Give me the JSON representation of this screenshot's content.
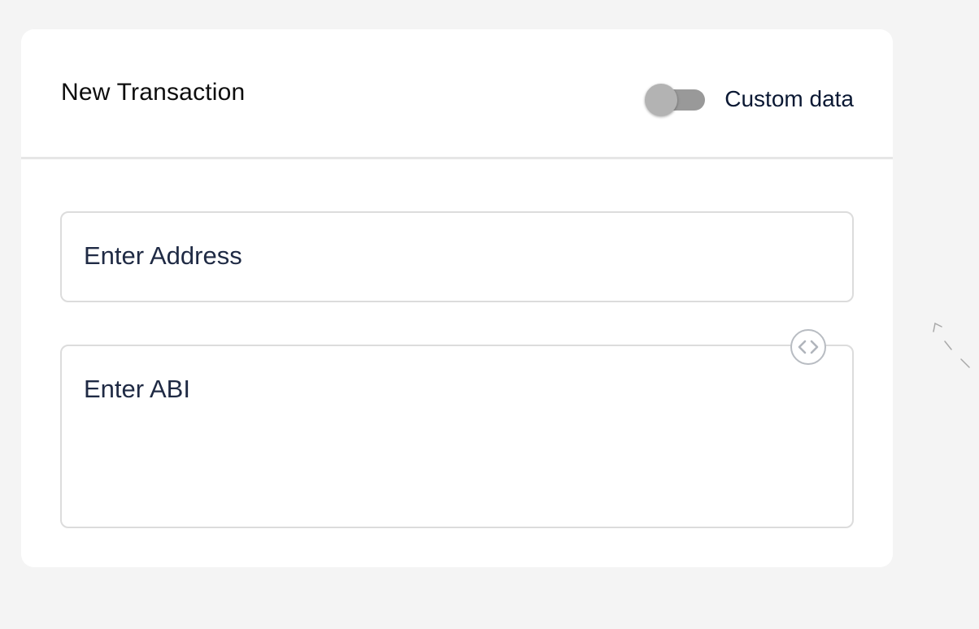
{
  "card": {
    "title": "New Transaction",
    "custom_data_toggle": {
      "label": "Custom data",
      "checked": false
    }
  },
  "form": {
    "address": {
      "placeholder": "Enter Address",
      "value": ""
    },
    "abi": {
      "placeholder": "Enter ABI",
      "value": ""
    },
    "code_button_icon": "code-brackets-icon"
  },
  "colors": {
    "background": "#f4f4f4",
    "card": "#ffffff",
    "divider": "#e6e6e6",
    "input_border": "#dcdcdc",
    "toggle_track": "#999999",
    "toggle_thumb": "#b3b3b3",
    "text_dark": "#0a1833"
  }
}
